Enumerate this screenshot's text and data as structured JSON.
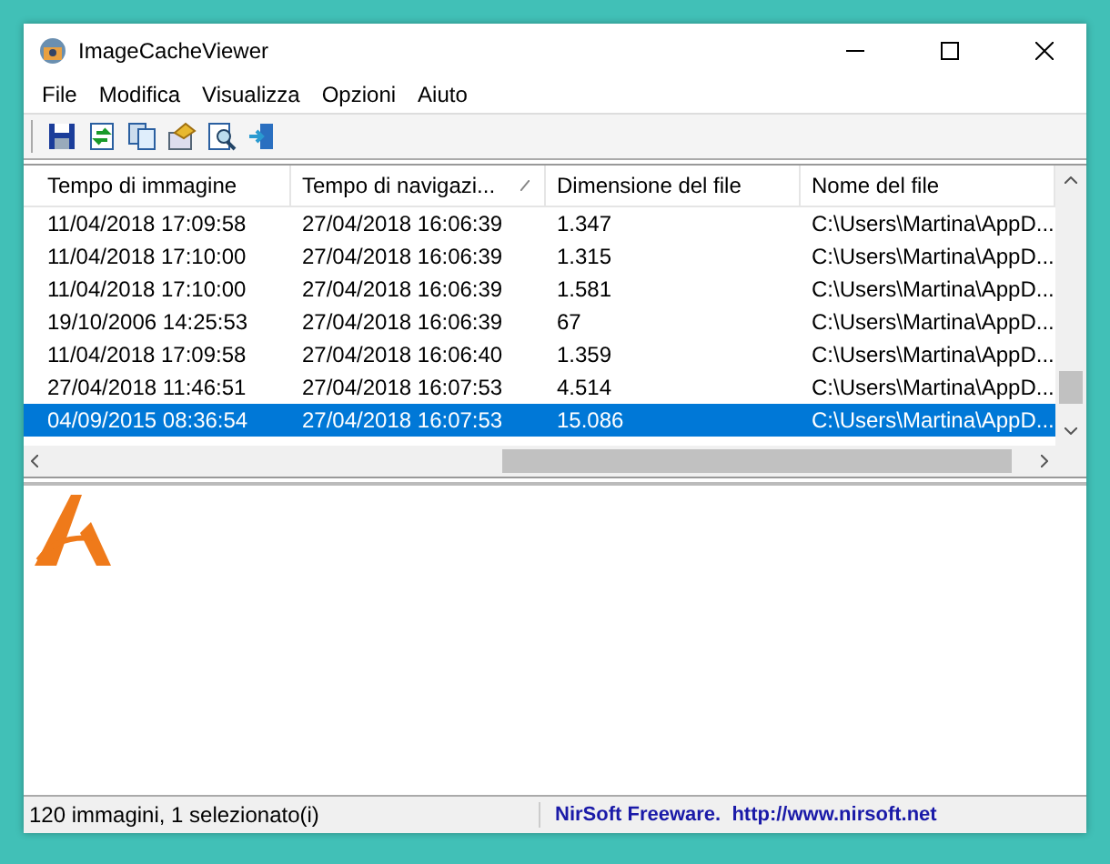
{
  "window": {
    "title": "ImageCacheViewer"
  },
  "menu": [
    "File",
    "Modifica",
    "Visualizza",
    "Opzioni",
    "Aiuto"
  ],
  "table": {
    "columns": [
      {
        "label": "Tempo di immagine",
        "sorted": false
      },
      {
        "label": "Tempo di navigazi...",
        "sorted": true
      },
      {
        "label": "Dimensione del file",
        "sorted": false
      },
      {
        "label": "Nome del file",
        "sorted": false
      }
    ],
    "rows": [
      {
        "cells": [
          "11/04/2018 17:09:58",
          "27/04/2018 16:06:39",
          "1.347",
          "C:\\Users\\Martina\\AppD..."
        ],
        "selected": false
      },
      {
        "cells": [
          "11/04/2018 17:10:00",
          "27/04/2018 16:06:39",
          "1.315",
          "C:\\Users\\Martina\\AppD..."
        ],
        "selected": false
      },
      {
        "cells": [
          "11/04/2018 17:10:00",
          "27/04/2018 16:06:39",
          "1.581",
          "C:\\Users\\Martina\\AppD..."
        ],
        "selected": false
      },
      {
        "cells": [
          "19/10/2006 14:25:53",
          "27/04/2018 16:06:39",
          "67",
          "C:\\Users\\Martina\\AppD..."
        ],
        "selected": false
      },
      {
        "cells": [
          "11/04/2018 17:09:58",
          "27/04/2018 16:06:40",
          "1.359",
          "C:\\Users\\Martina\\AppD..."
        ],
        "selected": false
      },
      {
        "cells": [
          "27/04/2018 11:46:51",
          "27/04/2018 16:07:53",
          "4.514",
          "C:\\Users\\Martina\\AppD..."
        ],
        "selected": false
      },
      {
        "cells": [
          "04/09/2015 08:36:54",
          "27/04/2018 16:07:53",
          "15.086",
          "C:\\Users\\Martina\\AppD..."
        ],
        "selected": true
      }
    ]
  },
  "status_bar": {
    "summary": "120 immagini, 1 selezionato(i)",
    "credit": "NirSoft Freeware.  http://www.nirsoft.net"
  }
}
